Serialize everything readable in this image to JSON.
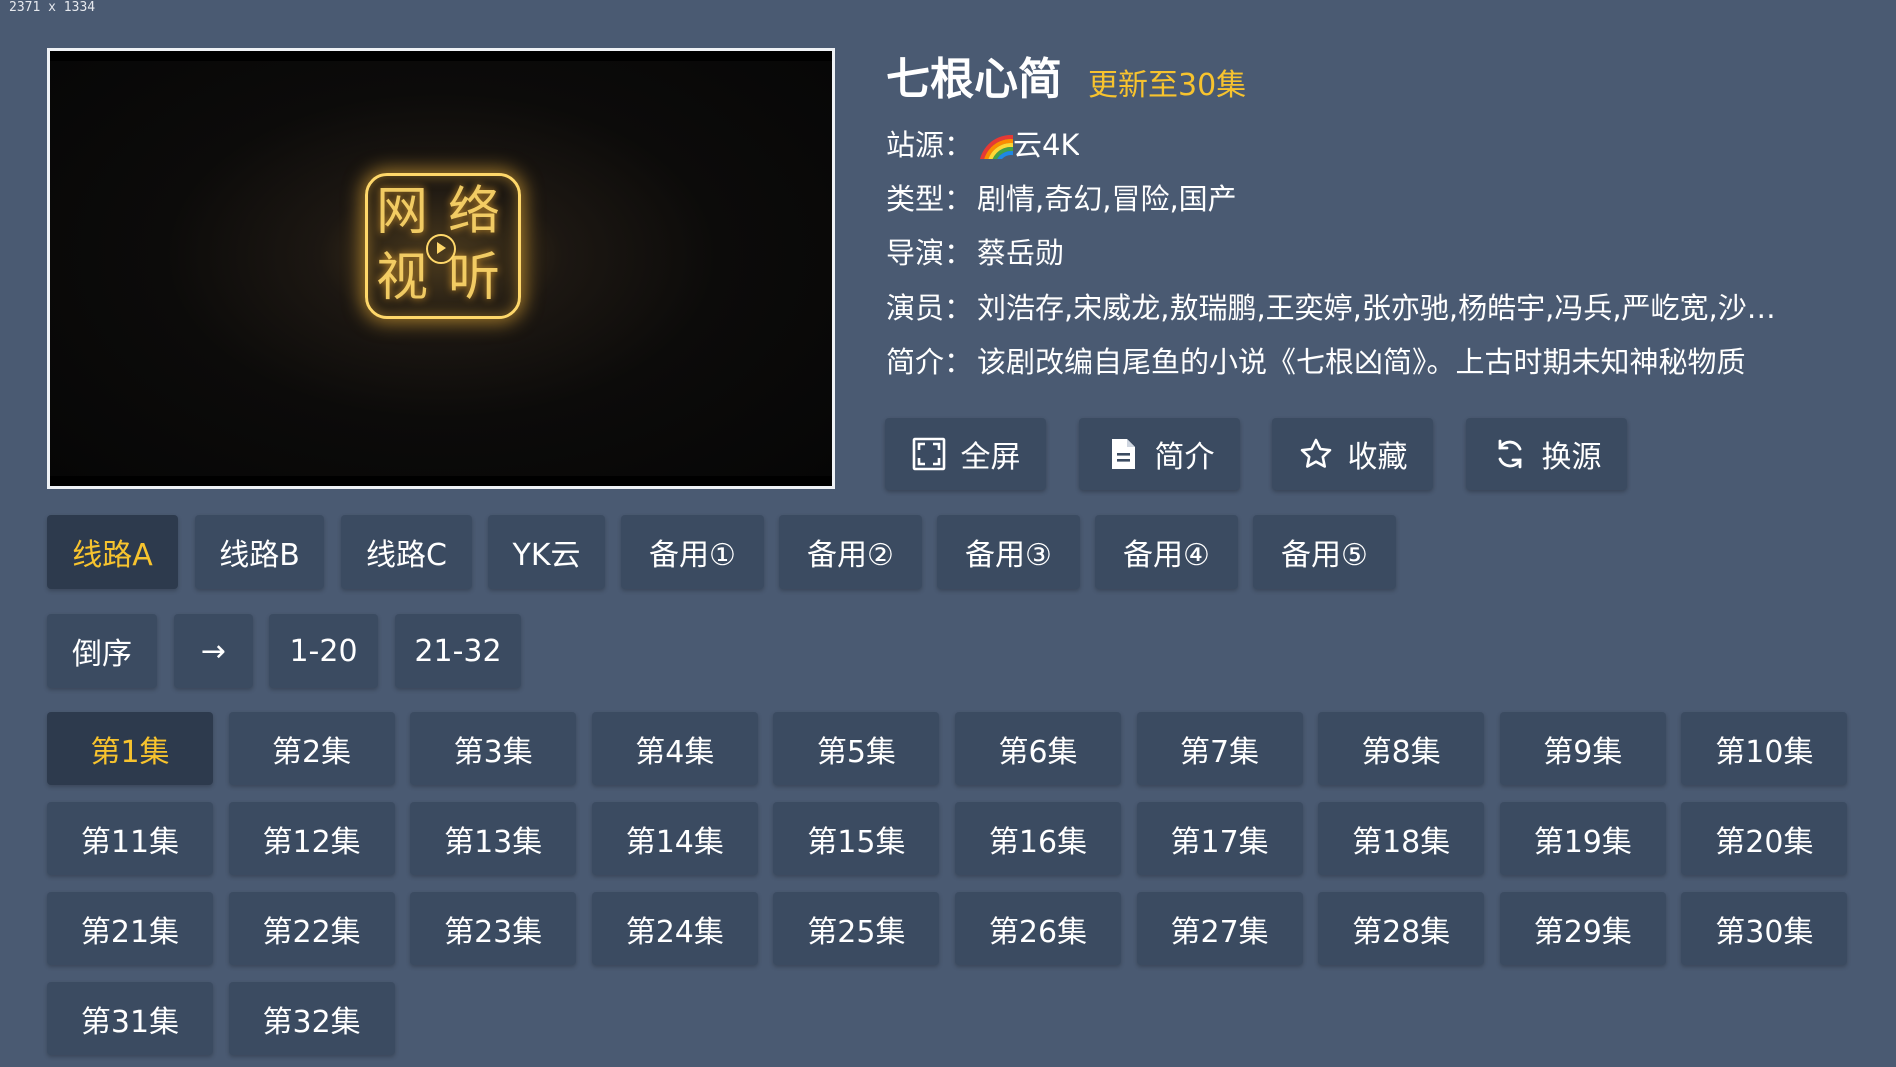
{
  "dims_label": "2371 x 1334",
  "show": {
    "title": "七根心简",
    "update_status": "更新至30集",
    "source_label": "站源：",
    "source_value": "云4K",
    "genre_label": "类型：",
    "genre_value": "剧情,奇幻,冒险,国产",
    "director_label": "导演：",
    "director_value": "蔡岳勋",
    "cast_label": "演员：",
    "cast_value": "刘浩存,宋威龙,敖瑞鹏,王奕婷,张亦驰,杨皓宇,冯兵,严屹宽,沙…",
    "synopsis_label": "简介：",
    "synopsis_value": "该剧改编自尾鱼的小说《七根凶简》。上古时期未知神秘物质"
  },
  "player": {
    "logo_text": [
      "网",
      "络",
      "视",
      "听"
    ]
  },
  "actions": {
    "fullscreen": "全屏",
    "intro": "简介",
    "favorite": "收藏",
    "switch_source": "换源"
  },
  "routes": [
    "线路A",
    "线路B",
    "线路C",
    "YK云",
    "备用①",
    "备用②",
    "备用③",
    "备用④",
    "备用⑤"
  ],
  "selected_route": "线路A",
  "controls": {
    "reverse": "倒序",
    "arrow": "→",
    "range1": "1-20",
    "range2": "21-32"
  },
  "episodes": [
    "第1集",
    "第2集",
    "第3集",
    "第4集",
    "第5集",
    "第6集",
    "第7集",
    "第8集",
    "第9集",
    "第10集",
    "第11集",
    "第12集",
    "第13集",
    "第14集",
    "第15集",
    "第16集",
    "第17集",
    "第18集",
    "第19集",
    "第20集",
    "第21集",
    "第22集",
    "第23集",
    "第24集",
    "第25集",
    "第26集",
    "第27集",
    "第28集",
    "第29集",
    "第30集",
    "第31集",
    "第32集"
  ],
  "selected_episode": "第1集",
  "colors": {
    "background": "#4a5a72",
    "button": "#3b4b61",
    "button_selected": "#2d3a4d",
    "accent": "#f7c32e"
  }
}
